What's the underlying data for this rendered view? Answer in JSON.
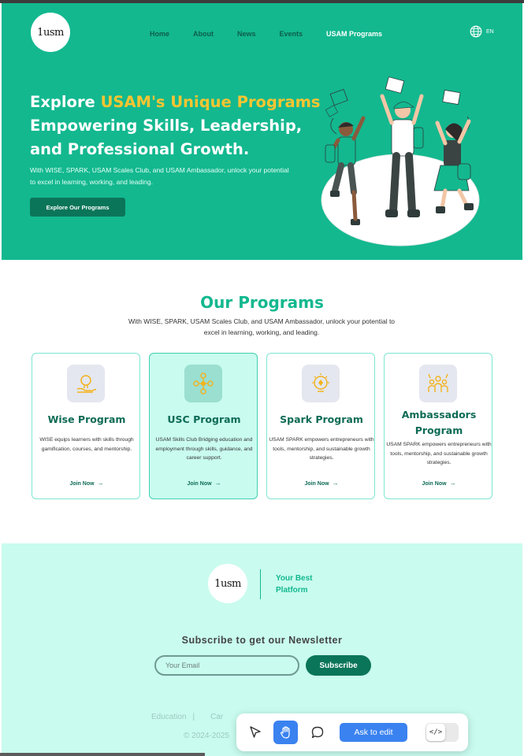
{
  "brand": {
    "logo_text": "1usm"
  },
  "nav": {
    "items": [
      {
        "label": "Home"
      },
      {
        "label": "About"
      },
      {
        "label": "News"
      },
      {
        "label": "Events"
      },
      {
        "label": "USAM Programs"
      }
    ],
    "language": "EN",
    "language_icon": "globe-icon"
  },
  "hero": {
    "title_prefix": "Explore ",
    "title_highlight": "USAM's Unique Programs",
    "title_rest": "Empowering Skills, Leadership, and Professional Growth.",
    "subtitle": "With WISE, SPARK, USAM Scales Club, and USAM Ambassador, unlock your potential to excel in learning, working, and leading.",
    "button_label": "Explore Our Programs",
    "illustration": "students-jumping-illustration"
  },
  "programs": {
    "title": "Our Programs",
    "subtitle": "With WISE, SPARK, USAM Scales Club, and USAM Ambassador, unlock your potential to excel in learning, working, and leading.",
    "cards": [
      {
        "title": "Wise Program",
        "description": "WISE equips learners with skills through gamification, courses, and mentorship.",
        "link": "Join Now",
        "icon": "lightbulb-hand-icon"
      },
      {
        "title": "USC Program",
        "description": "USAM Skills Club Bridging education and employment through skills, guidance, and career support.",
        "link": "Join Now",
        "icon": "network-people-icon"
      },
      {
        "title": "Spark Program",
        "description": "USAM SPARK empowers entrepreneurs with tools, mentorship, and sustainable growth strategies.",
        "link": "Join Now",
        "icon": "idea-bulb-icon"
      },
      {
        "title": "Ambassadors Program",
        "description": "USAM SPARK empowers entrepreneurs with tools, mentorship, and sustainable growth strategies.",
        "link": "Join Now",
        "icon": "team-hands-up-icon"
      }
    ]
  },
  "footer": {
    "slogan": "Your Best Platform",
    "newsletter_title": "Subscribe to get our Newsletter",
    "email_placeholder": "Your Email",
    "subscribe_label": "Subscribe",
    "links": [
      "Education",
      "Car"
    ],
    "copyright": "© 2024-2025"
  },
  "toolbar": {
    "ask_label": "Ask to edit",
    "code_label": "</>"
  },
  "colors": {
    "primary": "#13b88f",
    "dark_green": "#0b7559",
    "accent_yellow": "#f7c531",
    "footer_bg": "#c9fbef",
    "toolbar_blue": "#3a82f0"
  }
}
